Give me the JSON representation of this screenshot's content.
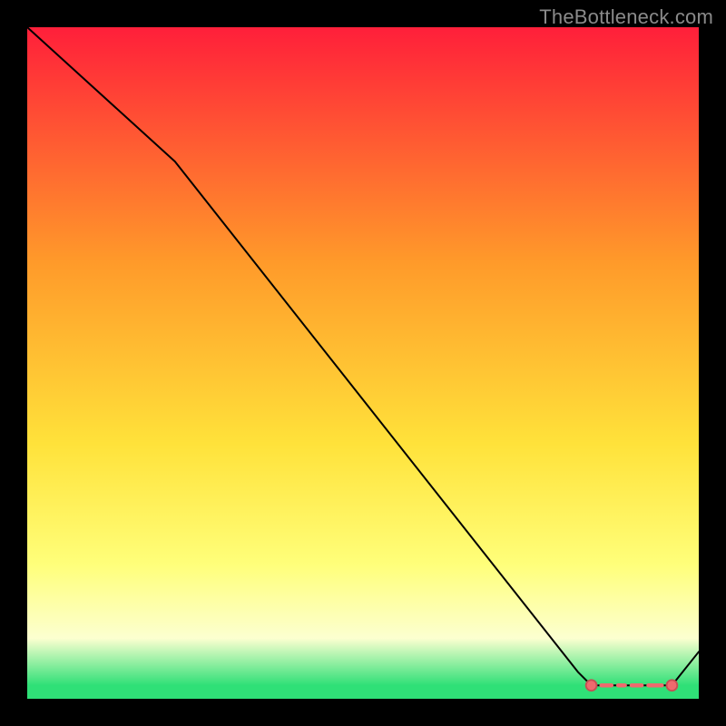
{
  "attribution": "TheBottleneck.com",
  "colors": {
    "top": "#ff1f3a",
    "upper_mid": "#ff9a2a",
    "mid": "#ffe23a",
    "lower_mid": "#ffff7a",
    "pale": "#fcffd0",
    "green": "#2fe077",
    "line": "#000000",
    "dot": "#ee6a6e",
    "dot_stroke": "#c64f53"
  },
  "chart_data": {
    "type": "line",
    "x": [
      0,
      22,
      82,
      84,
      92,
      96,
      100
    ],
    "values": [
      100,
      80,
      4,
      2,
      2,
      2,
      7
    ],
    "xlim": [
      0,
      100
    ],
    "ylim": [
      0,
      100
    ],
    "xlabel": "",
    "ylabel": "",
    "title": "",
    "dots": [
      {
        "x": 84,
        "y": 2
      },
      {
        "x": 96,
        "y": 2
      }
    ],
    "dashes": [
      {
        "x0": 85.5,
        "y0": 2,
        "x1": 87,
        "y1": 2
      },
      {
        "x0": 88,
        "y0": 2,
        "x1": 89,
        "y1": 2
      },
      {
        "x0": 90,
        "y0": 2,
        "x1": 91.5,
        "y1": 2
      },
      {
        "x0": 92.5,
        "y0": 2,
        "x1": 94.5,
        "y1": 2
      }
    ]
  }
}
